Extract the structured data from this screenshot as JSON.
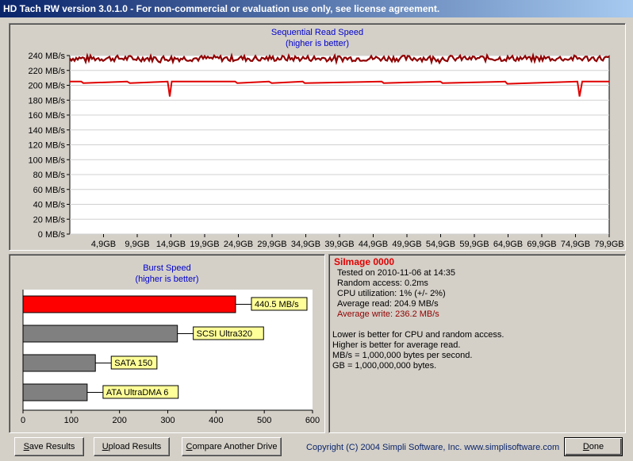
{
  "window": {
    "title": "HD Tach RW version 3.0.1.0  - For non-commercial or evaluation use only, see license agreement."
  },
  "colors": {
    "titlebar_start": "#0a246a",
    "titlebar_end": "#a6caf0",
    "read_line": "#e00000",
    "write_line": "#900000",
    "drive_bar": "#ff0000",
    "reference_bar": "#808080",
    "label_bg": "#ffff99",
    "chart_title": "#0000cc"
  },
  "seq_chart": {
    "title": "Sequential Read Speed",
    "subtitle": "(higher is better)"
  },
  "burst_chart": {
    "title": "Burst Speed",
    "subtitle": "(higher is better)"
  },
  "chart_data": [
    {
      "type": "line",
      "title": "Sequential Read Speed",
      "subtitle": "(higher is better)",
      "y_ticks": [
        "0 MB/s",
        "20 MB/s",
        "40 MB/s",
        "60 MB/s",
        "80 MB/s",
        "100 MB/s",
        "120 MB/s",
        "140 MB/s",
        "160 MB/s",
        "180 MB/s",
        "200 MB/s",
        "220 MB/s",
        "240 MB/s"
      ],
      "x_ticks": [
        "4,9GB",
        "9,9GB",
        "14,9GB",
        "19,9GB",
        "24,9GB",
        "29,9GB",
        "34,9GB",
        "39,9GB",
        "44,9GB",
        "49,9GB",
        "54,9GB",
        "59,9GB",
        "64,9GB",
        "69,9GB",
        "74,9GB",
        "79,9GB"
      ],
      "ylim": [
        0,
        240
      ],
      "xlim": [
        0,
        79.9
      ],
      "series": [
        {
          "name": "Average read",
          "color": "#e00000",
          "x": [
            0,
            1.7,
            2.0,
            8.5,
            8.9,
            14.5,
            14.8,
            15.1,
            15.6,
            24.5,
            24.8,
            29.5,
            29.9,
            34.5,
            34.8,
            46.2,
            46.5,
            54.9,
            55.2,
            64.5,
            64.8,
            75.2,
            75.5,
            75.9,
            76.2,
            79.9
          ],
          "y": [
            205,
            205,
            203,
            205,
            203,
            205,
            185,
            205,
            205,
            205,
            203,
            205,
            203,
            205,
            203,
            205,
            203,
            205,
            203,
            205,
            202,
            205,
            185,
            205,
            205,
            205
          ]
        },
        {
          "name": "Average write",
          "color": "#900000",
          "x": [
            0,
            79.9
          ],
          "y": [
            236.2,
            236.2
          ]
        }
      ]
    },
    {
      "type": "bar",
      "title": "Burst Speed",
      "subtitle": "(higher is better)",
      "categories": [
        "440.5 MB/s",
        "SCSI Ultra320",
        "SATA 150",
        "ATA UltraDMA 6"
      ],
      "values": [
        440.5,
        320,
        150,
        133
      ],
      "colors": [
        "#ff0000",
        "#808080",
        "#808080",
        "#808080"
      ],
      "x_ticks": [
        "0",
        "100",
        "200",
        "300",
        "400",
        "500",
        "600"
      ],
      "xlim": [
        0,
        600
      ]
    }
  ],
  "results": {
    "drive_name": "SiImage 0000",
    "tested": "Tested on 2010-11-06 at 14:35",
    "random_access": "Random access: 0.2ms",
    "cpu": "CPU utilization: 1% (+/- 2%)",
    "avg_read": "Average read: 204.9 MB/s",
    "avg_write": "Average write: 236.2 MB/s",
    "notes": [
      "Lower is better for CPU and random access.",
      "Higher is better for average read.",
      "MB/s = 1,000,000 bytes per second.",
      "GB = 1,000,000,000 bytes."
    ]
  },
  "buttons": {
    "save": {
      "prefix": "",
      "accel": "S",
      "rest": "ave Results"
    },
    "upload": {
      "prefix": "",
      "accel": "U",
      "rest": "pload Results"
    },
    "compare": {
      "prefix": "",
      "accel": "C",
      "rest": "ompare Another Drive"
    },
    "done": {
      "prefix": "",
      "accel": "D",
      "rest": "one"
    }
  },
  "copyright": "Copyright (C) 2004 Simpli Software, Inc. www.simplisoftware.com"
}
